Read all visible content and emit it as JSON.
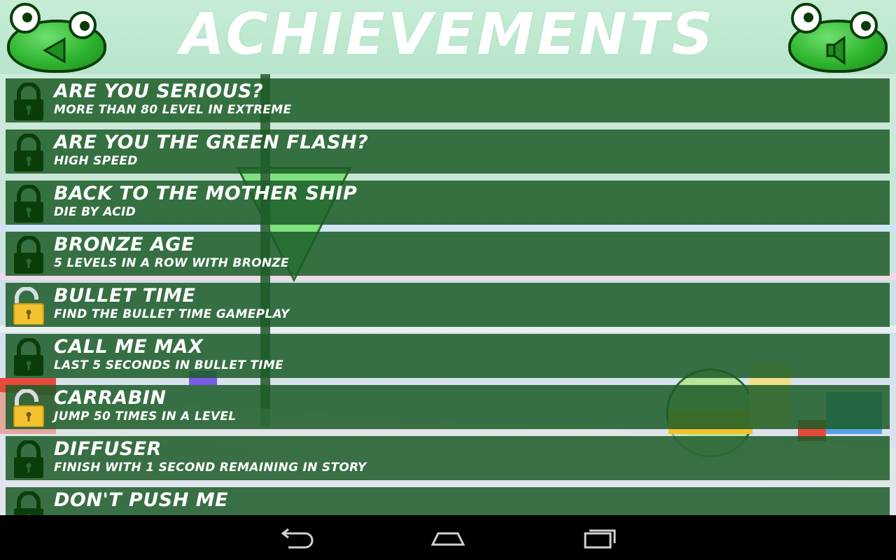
{
  "header": {
    "title": "ACHIEVEMENTS",
    "back_icon": "back-triangle-icon",
    "sound_icon": "speaker-icon"
  },
  "colors": {
    "row_bg": "#1c5c28",
    "frog_green": "#2fb52f",
    "locked_icon": "#0b3d0b",
    "unlocked_icon": "#f2c230"
  },
  "achievements": [
    {
      "title": "ARE YOU SERIOUS?",
      "description": "MORE THAN 80 LEVEL IN EXTREME",
      "unlocked": false
    },
    {
      "title": "ARE YOU THE GREEN FLASH?",
      "description": "HIGH SPEED",
      "unlocked": false
    },
    {
      "title": "BACK TO THE MOTHER SHIP",
      "description": "DIE BY ACID",
      "unlocked": false
    },
    {
      "title": "BRONZE AGE",
      "description": "5 LEVELS IN A ROW WITH BRONZE",
      "unlocked": false
    },
    {
      "title": "BULLET TIME",
      "description": "FIND THE BULLET TIME GAMEPLAY",
      "unlocked": true
    },
    {
      "title": "CALL ME MAX",
      "description": "LAST 5 SECONDS IN BULLET TIME",
      "unlocked": false
    },
    {
      "title": "CARRABIN",
      "description": "JUMP 50 TIMES IN A LEVEL",
      "unlocked": true
    },
    {
      "title": "DIFFUSER",
      "description": "FINISH WITH 1 SECOND REMAINING IN STORY",
      "unlocked": false
    },
    {
      "title": "DON'T PUSH ME",
      "description": "",
      "unlocked": false
    }
  ],
  "navbar": {
    "back": "nav-back-icon",
    "home": "nav-home-icon",
    "recents": "nav-recents-icon"
  }
}
